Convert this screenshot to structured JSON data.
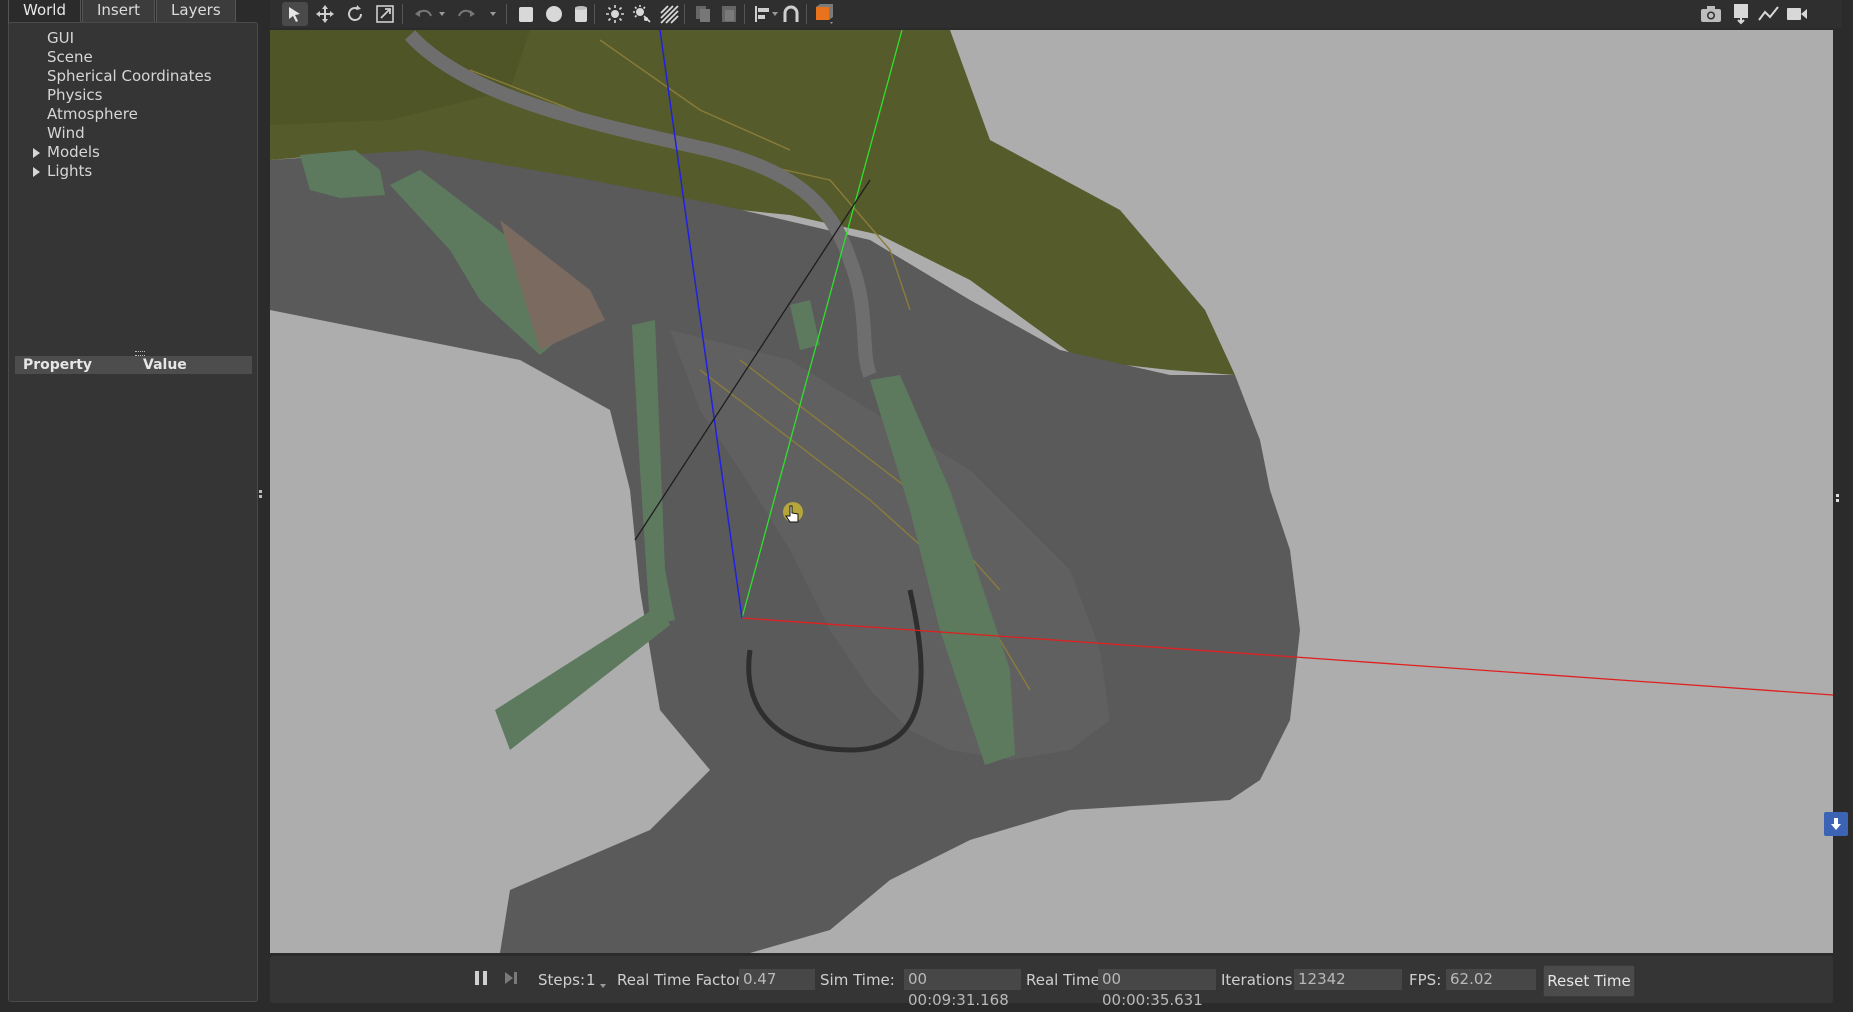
{
  "tabs": [
    {
      "label": "World",
      "active": true
    },
    {
      "label": "Insert",
      "active": false
    },
    {
      "label": "Layers",
      "active": false
    }
  ],
  "world_tree": [
    {
      "label": "GUI",
      "expandable": false
    },
    {
      "label": "Scene",
      "expandable": false
    },
    {
      "label": "Spherical Coordinates",
      "expandable": false
    },
    {
      "label": "Physics",
      "expandable": false
    },
    {
      "label": "Atmosphere",
      "expandable": false
    },
    {
      "label": "Wind",
      "expandable": false
    },
    {
      "label": "Models",
      "expandable": true
    },
    {
      "label": "Lights",
      "expandable": true
    }
  ],
  "property_table": {
    "col_property": "Property",
    "col_value": "Value"
  },
  "toolbar": {
    "tools": [
      "select-mode-icon",
      "translate-mode-icon",
      "rotate-mode-icon",
      "scale-mode-icon",
      "undo-icon",
      "redo-icon",
      "box-shape-icon",
      "sphere-shape-icon",
      "cylinder-shape-icon",
      "point-light-icon",
      "spot-light-icon",
      "directional-light-icon",
      "copy-icon",
      "paste-icon",
      "align-icon",
      "snap-icon",
      "view-angle-icon",
      "screenshot-icon",
      "log-icon",
      "plot-icon",
      "record-video-icon"
    ],
    "active_tool": "select-mode-icon",
    "accent_color": "#e8731c"
  },
  "status": {
    "steps_label": "Steps:",
    "steps_value": "1",
    "rtf_label": "Real Time Factor:",
    "rtf_value": "0.47",
    "sim_time_label": "Sim Time:",
    "sim_time_value": "00 00:09:31.168",
    "real_time_label": "Real Time:",
    "real_time_value": "00 00:00:35.631",
    "iterations_label": "Iterations:",
    "iterations_value": "12342",
    "fps_label": "FPS:",
    "fps_value": "62.02",
    "reset_label": "Reset Time"
  },
  "scene": {
    "background_color": "#adadad",
    "terrain_color": "#555b2a",
    "asphalt_color": "#5a5a5a",
    "building_color": "#5d7a5f",
    "axis_colors": {
      "x": "#e02020",
      "y": "#2ee02e",
      "z": "#2020e0"
    }
  }
}
